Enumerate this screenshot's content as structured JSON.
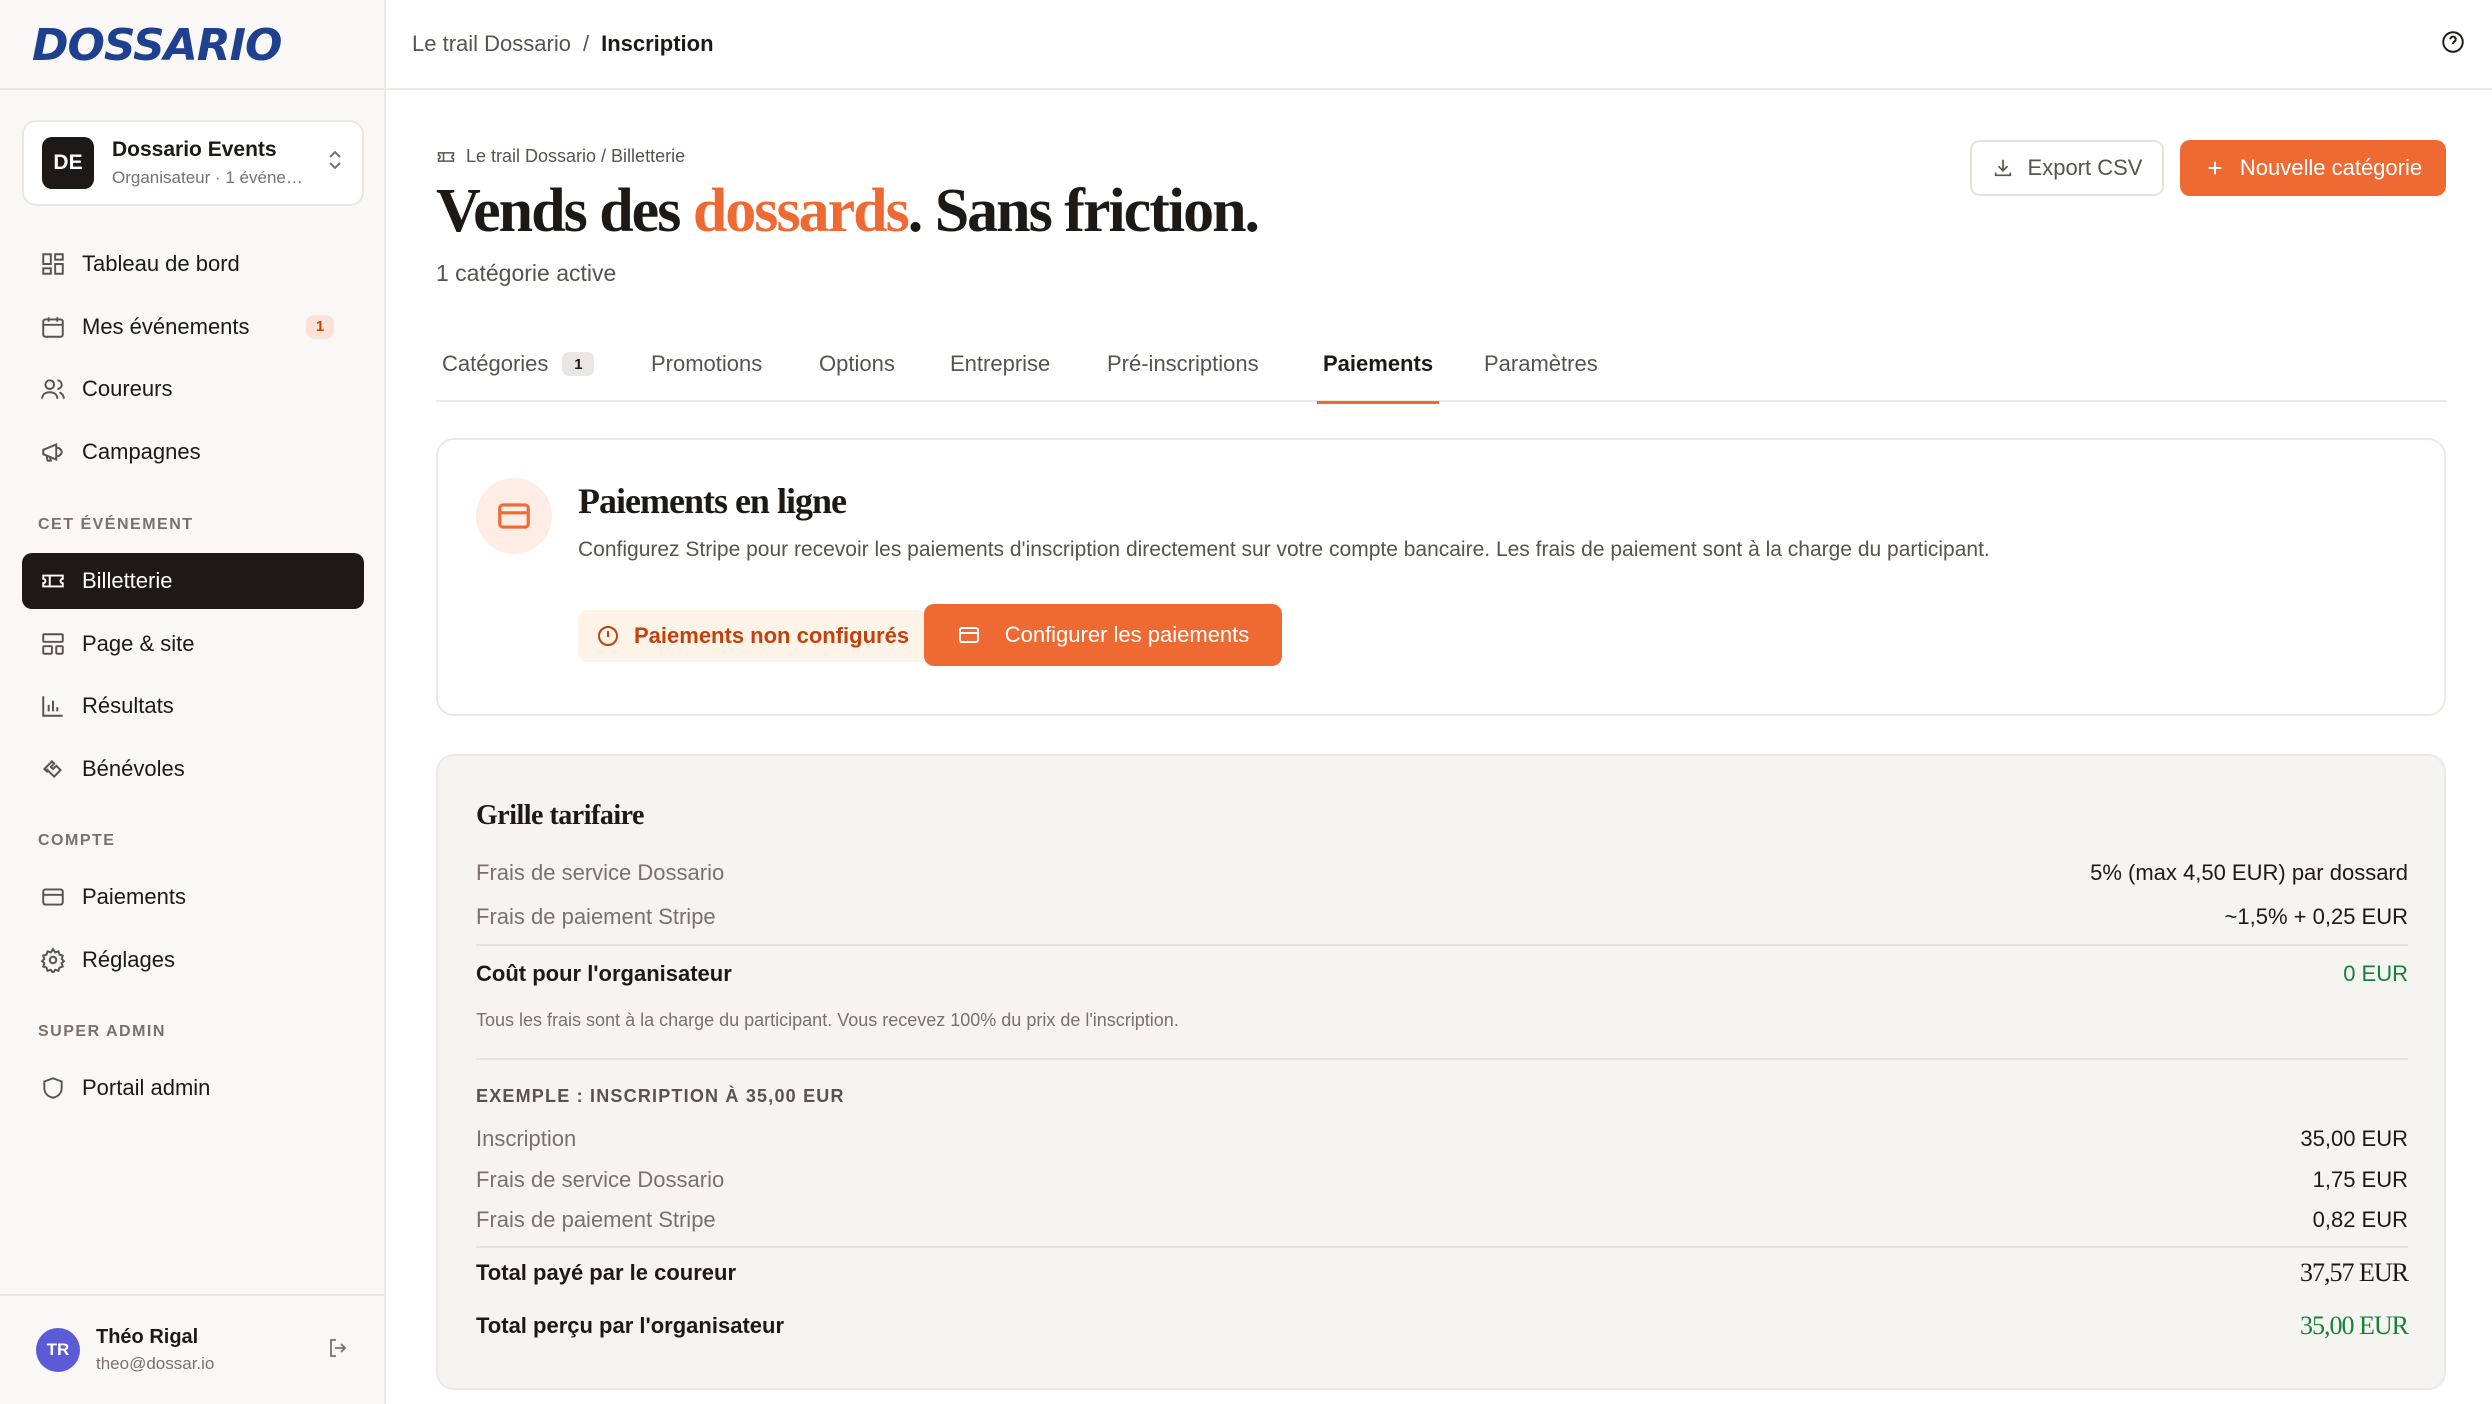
{
  "brand": {
    "logo_text": "DOSSARIO",
    "accent": "#ef6a32",
    "dark": "#1c1917"
  },
  "org": {
    "initials": "DE",
    "name": "Dossario Events",
    "subtitle": "Organisateur · 1 événement"
  },
  "nav": {
    "main": [
      {
        "label": "Tableau de bord",
        "icon": "dashboard-icon"
      },
      {
        "label": "Mes événements",
        "icon": "calendar-icon",
        "badge": "1"
      },
      {
        "label": "Coureurs",
        "icon": "users-icon"
      },
      {
        "label": "Campagnes",
        "icon": "megaphone-icon"
      }
    ],
    "section_event": "CET ÉVÉNEMENT",
    "event": [
      {
        "label": "Billetterie",
        "icon": "ticket-icon",
        "active": true
      },
      {
        "label": "Page & site",
        "icon": "layout-icon"
      },
      {
        "label": "Résultats",
        "icon": "chart-icon"
      },
      {
        "label": "Bénévoles",
        "icon": "handshake-icon"
      }
    ],
    "section_account": "COMPTE",
    "account": [
      {
        "label": "Paiements",
        "icon": "credit-card-icon"
      },
      {
        "label": "Réglages",
        "icon": "gear-icon"
      }
    ],
    "section_super": "SUPER ADMIN",
    "super": [
      {
        "label": "Portail admin",
        "icon": "shield-icon"
      }
    ]
  },
  "user": {
    "initials": "TR",
    "name": "Théo Rigal",
    "email": "theo@dossar.io"
  },
  "topbar": {
    "crumb_parent": "Le trail Dossario",
    "separator": "/",
    "crumb_current": "Inscription"
  },
  "header": {
    "subcrumb": "Le trail Dossario / Billetterie",
    "title_part1": "Vends des ",
    "title_accent": "dossards",
    "title_part2": ". Sans friction.",
    "subtitle": "1 catégorie active",
    "export_label": "Export CSV",
    "new_label": "Nouvelle catégorie"
  },
  "tabs": [
    {
      "label": "Catégories",
      "badge": "1"
    },
    {
      "label": "Promotions"
    },
    {
      "label": "Options"
    },
    {
      "label": "Entreprise"
    },
    {
      "label": "Pré-inscriptions"
    },
    {
      "label": "Paiements",
      "active": true
    },
    {
      "label": "Paramètres"
    }
  ],
  "payments": {
    "title": "Paiements en ligne",
    "description": "Configurez Stripe pour recevoir les paiements d'inscription directement sur votre compte bancaire. Les frais de paiement sont à la charge du participant.",
    "status": "Paiements non configurés",
    "configure_label": "Configurer les paiements"
  },
  "pricing": {
    "title": "Grille tarifaire",
    "rows": [
      {
        "label": "Frais de service Dossario",
        "value": "5% (max 4,50 EUR) par dossard"
      },
      {
        "label": "Frais de paiement Stripe",
        "value": "~1,5% + 0,25 EUR"
      }
    ],
    "organizer_cost_label": "Coût pour l'organisateur",
    "organizer_cost_value": "0 EUR",
    "note": "Tous les frais sont à la charge du participant. Vous recevez 100% du prix de l'inscription.",
    "example_heading": "EXEMPLE : INSCRIPTION À 35,00 EUR",
    "example_rows": [
      {
        "label": "Inscription",
        "value": "35,00 EUR"
      },
      {
        "label": "Frais de service Dossario",
        "value": "1,75 EUR"
      },
      {
        "label": "Frais de paiement Stripe",
        "value": "0,82 EUR"
      }
    ],
    "total_paid_label": "Total payé par le coureur",
    "total_paid_value": "37,57 EUR",
    "total_received_label": "Total perçu par l'organisateur",
    "total_received_value": "35,00 EUR"
  }
}
